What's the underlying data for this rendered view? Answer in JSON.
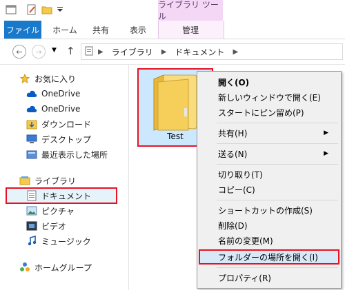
{
  "titlebar": {
    "context_tab_header": "ライブラリ ツール"
  },
  "ribbon": {
    "tabs": [
      {
        "label": "ファイル"
      },
      {
        "label": "ホーム"
      },
      {
        "label": "共有"
      },
      {
        "label": "表示"
      },
      {
        "label": "管理"
      }
    ]
  },
  "address": {
    "segments": [
      "ライブラリ",
      "ドキュメント"
    ]
  },
  "navpane": {
    "items": [
      {
        "label": "お気に入り",
        "icon": "star-icon"
      },
      {
        "label": "OneDrive",
        "icon": "cloud-icon"
      },
      {
        "label": "OneDrive",
        "icon": "cloud-icon"
      },
      {
        "label": "ダウンロード",
        "icon": "download-folder-icon"
      },
      {
        "label": "デスクトップ",
        "icon": "desktop-icon"
      },
      {
        "label": "最近表示した場所",
        "icon": "recent-places-icon"
      },
      {
        "label": "ライブラリ",
        "icon": "library-icon"
      },
      {
        "label": "ドキュメント",
        "icon": "documents-icon"
      },
      {
        "label": "ピクチャ",
        "icon": "pictures-icon"
      },
      {
        "label": "ビデオ",
        "icon": "videos-icon"
      },
      {
        "label": "ミュージック",
        "icon": "music-icon"
      },
      {
        "label": "ホームグループ",
        "icon": "homegroup-icon"
      }
    ]
  },
  "content": {
    "folder_name": "Test"
  },
  "context_menu": {
    "items": [
      {
        "label": "開く(O)"
      },
      {
        "label": "新しいウィンドウで開く(E)"
      },
      {
        "label": "スタートにピン留め(P)"
      },
      {
        "label": "共有(H)"
      },
      {
        "label": "送る(N)"
      },
      {
        "label": "切り取り(T)"
      },
      {
        "label": "コピー(C)"
      },
      {
        "label": "ショートカットの作成(S)"
      },
      {
        "label": "削除(D)"
      },
      {
        "label": "名前の変更(M)"
      },
      {
        "label": "フォルダーの場所を開く(I)"
      },
      {
        "label": "プロパティ(R)"
      }
    ]
  },
  "colors": {
    "accent": "#1979ca",
    "highlight_border": "#e81123",
    "context_tab": "#f3d7f5"
  }
}
